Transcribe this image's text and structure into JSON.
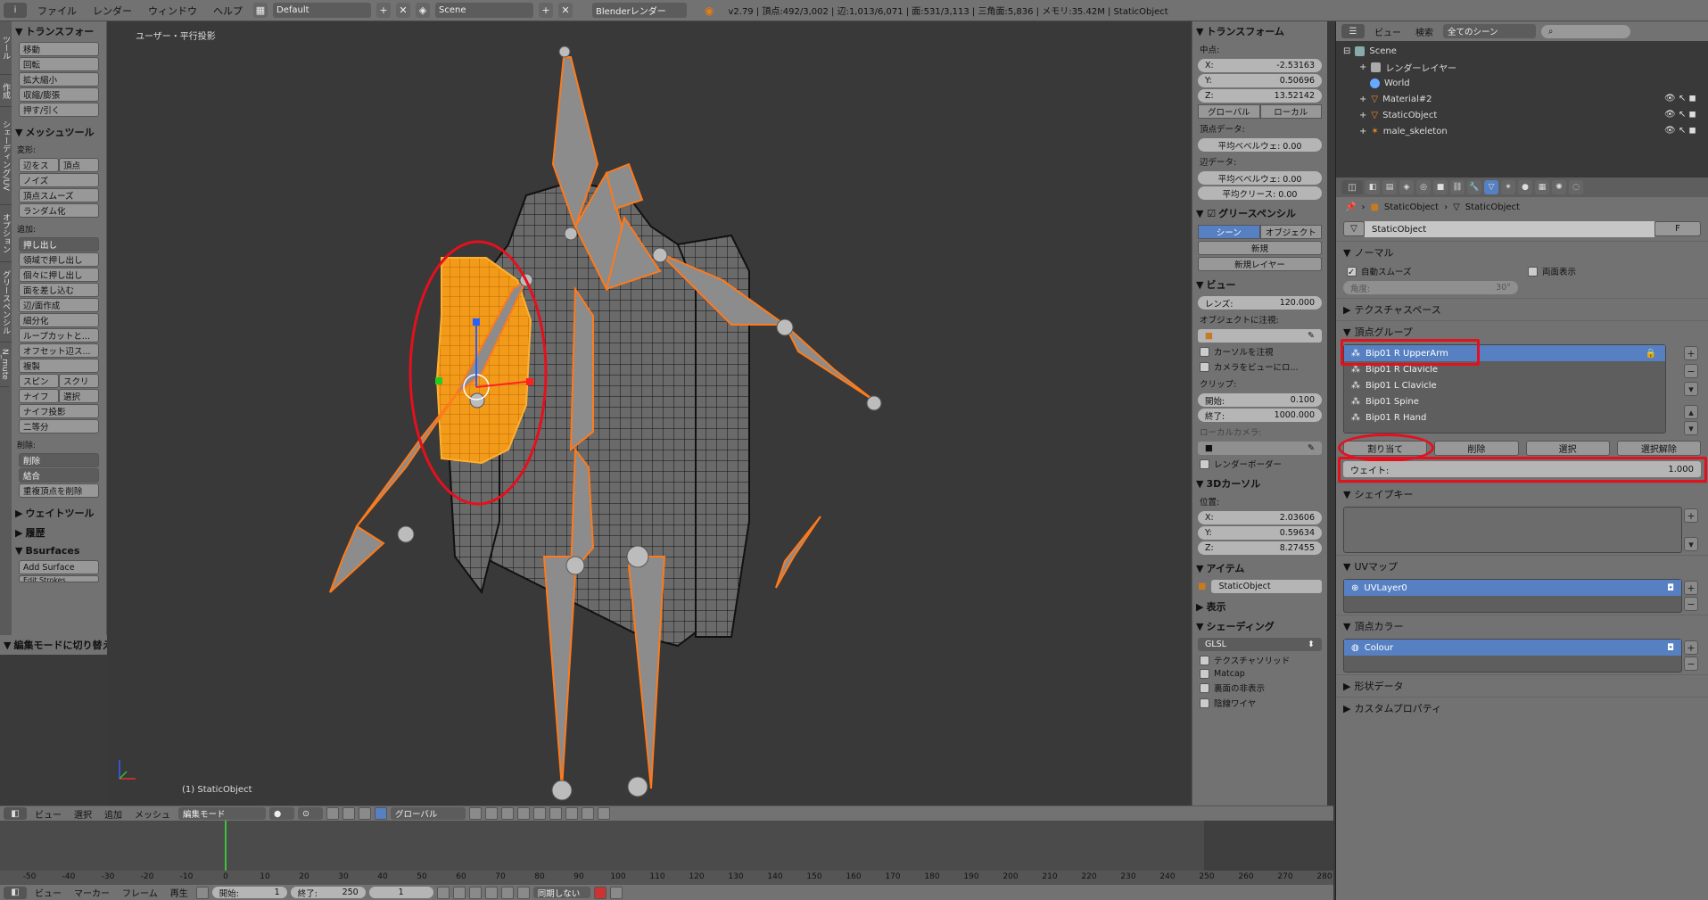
{
  "top_menu": {
    "editor": "i",
    "items": [
      "ファイル",
      "レンダー",
      "ウィンドウ",
      "ヘルプ"
    ],
    "layout": "Default",
    "scene": "Scene",
    "engine": "Blenderレンダー",
    "stats": "v2.79 | 頂点:492/3,002 | 辺:1,013/6,071 | 面:531/3,113 | 三角面:5,836 | メモリ:35.42M | StaticObject"
  },
  "tool_tabs": [
    "ツール",
    "作成",
    "シェーディング/UV",
    "オプション",
    "グリースペンシル",
    "N_mute"
  ],
  "toolshelf": {
    "transform_title": "トランスフォー",
    "transform_buttons": [
      "移動",
      "回転",
      "拡大縮小",
      "収縮/膨張",
      "押す/引く"
    ],
    "mesh_tools_title": "メッシュツール",
    "deform_label": "変形:",
    "slide_edge": "辺をス",
    "slide_vertex": "頂点",
    "deform_buttons": [
      "ノイズ",
      "頂点スムーズ",
      "ランダム化"
    ],
    "add_label": "追加:",
    "extrude": "押し出し",
    "add_buttons": [
      "領域で押し出し",
      "個々に押し出し",
      "面を差し込む",
      "辺/面作成",
      "細分化",
      "ループカットと...",
      "オフセット辺ス..."
    ],
    "duplicate": "複製",
    "spin": "スピン",
    "screw": "スクリ",
    "knife": "ナイフ",
    "select": "選択",
    "knife_project": "ナイフ投影",
    "bisect": "二等分",
    "remove_label": "削除:",
    "delete": "削除",
    "join": "結合",
    "remove_doubles": "重複頂点を削除",
    "weight_tools": "ウェイトツール",
    "history": "履歴",
    "bsurfaces": "Bsurfaces",
    "add_surface": "Add Surface",
    "edit_strokes": "Edit Strokes",
    "operator": "編集モードに切り替え"
  },
  "viewport": {
    "title": "ユーザー・平行投影",
    "object": "(1) StaticObject"
  },
  "npanel": {
    "transform": "トランスフォーム",
    "median": "中点:",
    "x_label": "X:",
    "x": "-2.53163",
    "y_label": "Y:",
    "y": "0.50696",
    "z_label": "Z:",
    "z": "13.52142",
    "global": "グローバル",
    "local": "ローカル",
    "vertex_data": "頂点データ:",
    "v_bevel": "平均ベベルウェ: 0.00",
    "edge_data": "辺データ:",
    "e_bevel": "平均ベベルウェ: 0.00",
    "e_crease": "平均クリース: 0.00",
    "grease": "グリースペンシル",
    "scene": "シーン",
    "object": "オブジェクト",
    "new": "新規",
    "new_layer": "新規レイヤー",
    "view": "ビュー",
    "lens_label": "レンズ:",
    "lens": "120.000",
    "lock_obj": "オブジェクトに注視:",
    "lock_cursor": "カーソルを注視",
    "lock_camera": "カメラをビューにロ...",
    "clip": "クリップ:",
    "clip_start_label": "開始:",
    "clip_start": "0.100",
    "clip_end_label": "終了:",
    "clip_end": "1000.000",
    "local_camera": "ローカルカメラ:",
    "render_border": "レンダーボーダー",
    "cursor3d": "3Dカーソル",
    "location": "位置:",
    "cx": "2.03606",
    "cy": "0.59634",
    "cz": "8.27455",
    "item": "アイテム",
    "item_name": "StaticObject",
    "display": "表示",
    "shading": "シェーディング",
    "glsl": "GLSL",
    "tex_solid": "テクスチャソリッド",
    "matcap": "Matcap",
    "backface": "裏面の非表示",
    "hidden_wire": "陰線ワイヤ"
  },
  "viewport_header": {
    "menus": [
      "ビュー",
      "選択",
      "追加",
      "メッシュ"
    ],
    "mode": "編集モード",
    "orientation": "グローバル"
  },
  "timeline": {
    "ticks": [
      "-50",
      "-40",
      "-30",
      "-20",
      "-10",
      "0",
      "10",
      "20",
      "30",
      "40",
      "50",
      "60",
      "70",
      "80",
      "90",
      "100",
      "110",
      "120",
      "130",
      "140",
      "150",
      "160",
      "170",
      "180",
      "190",
      "200",
      "210",
      "220",
      "230",
      "240",
      "250",
      "260",
      "270",
      "280"
    ],
    "menus": [
      "ビュー",
      "マーカー",
      "フレーム",
      "再生"
    ],
    "start_label": "開始:",
    "start": "1",
    "end_label": "終了:",
    "end": "250",
    "current": "1",
    "sync": "同期しない",
    "current_frame": 0
  },
  "outliner": {
    "menus": [
      "ビュー",
      "検索"
    ],
    "filter": "全てのシーン",
    "rows": [
      "Scene",
      "レンダーレイヤー",
      "World",
      "Material#2",
      "StaticObject",
      "male_skeleton"
    ]
  },
  "properties": {
    "breadcrumb1": "StaticObject",
    "breadcrumb2": "StaticObject",
    "mesh_name": "StaticObject",
    "fake_user": "F",
    "normals": "ノーマル",
    "auto_smooth": "自動スムーズ",
    "double_sided": "両面表示",
    "angle": "角度:",
    "angle_val": "30°",
    "texspace": "テクスチャスペース",
    "vgroups": "頂点グループ",
    "vgroup_items": [
      "Bip01 R UpperArm",
      "Bip01 R Clavicle",
      "Bip01 L Clavicle",
      "Bip01 Spine",
      "Bip01 R Hand"
    ],
    "assign": "割り当て",
    "remove": "削除",
    "select": "選択",
    "deselect": "選択解除",
    "weight_label": "ウェイト:",
    "weight": "1.000",
    "shapekeys": "シェイプキー",
    "uvmaps": "UVマップ",
    "uvlayer": "UVLayer0",
    "vcolors": "頂点カラー",
    "colour": "Colour",
    "geometry": "形状データ",
    "custom_props": "カスタムプロパティ"
  },
  "colors": {
    "highlight": "#5680c2",
    "annotation": "#e5101e",
    "selection": "#ff9a00"
  }
}
